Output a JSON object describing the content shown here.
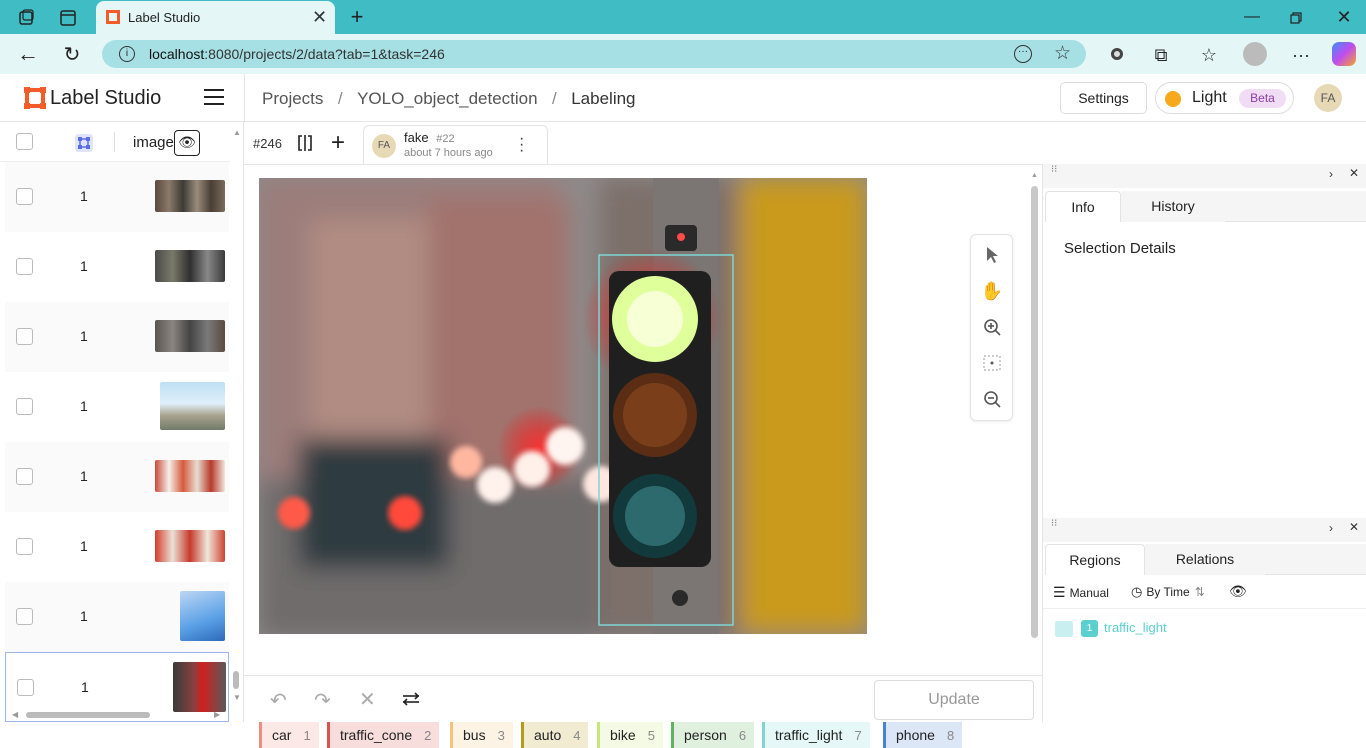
{
  "browser": {
    "tab_title": "Label Studio",
    "url_host": "localhost",
    "url_rest": ":8080/projects/2/data?tab=1&task=246"
  },
  "header": {
    "logo_text": "Label Studio",
    "crumbs": [
      "Projects",
      "YOLO_object_detection",
      "Labeling"
    ],
    "settings_label": "Settings",
    "theme_label": "Light",
    "beta_label": "Beta",
    "avatar": "FA"
  },
  "table": {
    "image_col": "image",
    "rows": [
      {
        "count": "1"
      },
      {
        "count": "1"
      },
      {
        "count": "1"
      },
      {
        "count": "1"
      },
      {
        "count": "1"
      },
      {
        "count": "1"
      },
      {
        "count": "1"
      },
      {
        "count": "1"
      }
    ]
  },
  "task": {
    "id": "#246",
    "annotator_avatar": "FA",
    "annotator": "fake",
    "annotation_id": "#22",
    "time": "about 7 hours ago"
  },
  "labels": [
    {
      "name": "car",
      "key": "1",
      "color": "#f28b82"
    },
    {
      "name": "traffic_cone",
      "key": "2",
      "color": "#d9534f"
    },
    {
      "name": "bus",
      "key": "3",
      "color": "#f6c27a"
    },
    {
      "name": "auto",
      "key": "4",
      "color": "#b59b17"
    },
    {
      "name": "bike",
      "key": "5",
      "color": "#c8e57a"
    },
    {
      "name": "person",
      "key": "6",
      "color": "#5fb25f"
    },
    {
      "name": "traffic_light",
      "key": "7",
      "color": "#7fd6d3"
    },
    {
      "name": "phone",
      "key": "8",
      "color": "#4a80d6"
    }
  ],
  "bottom": {
    "update_label": "Update"
  },
  "panel": {
    "tabs1": [
      "Info",
      "History"
    ],
    "selection_title": "Selection Details",
    "tabs2": [
      "Regions",
      "Relations"
    ],
    "manual_label": "Manual",
    "bytime_label": "By Time",
    "region_index": "1",
    "region_label": "traffic_light",
    "accent": "#5ccfd0"
  }
}
